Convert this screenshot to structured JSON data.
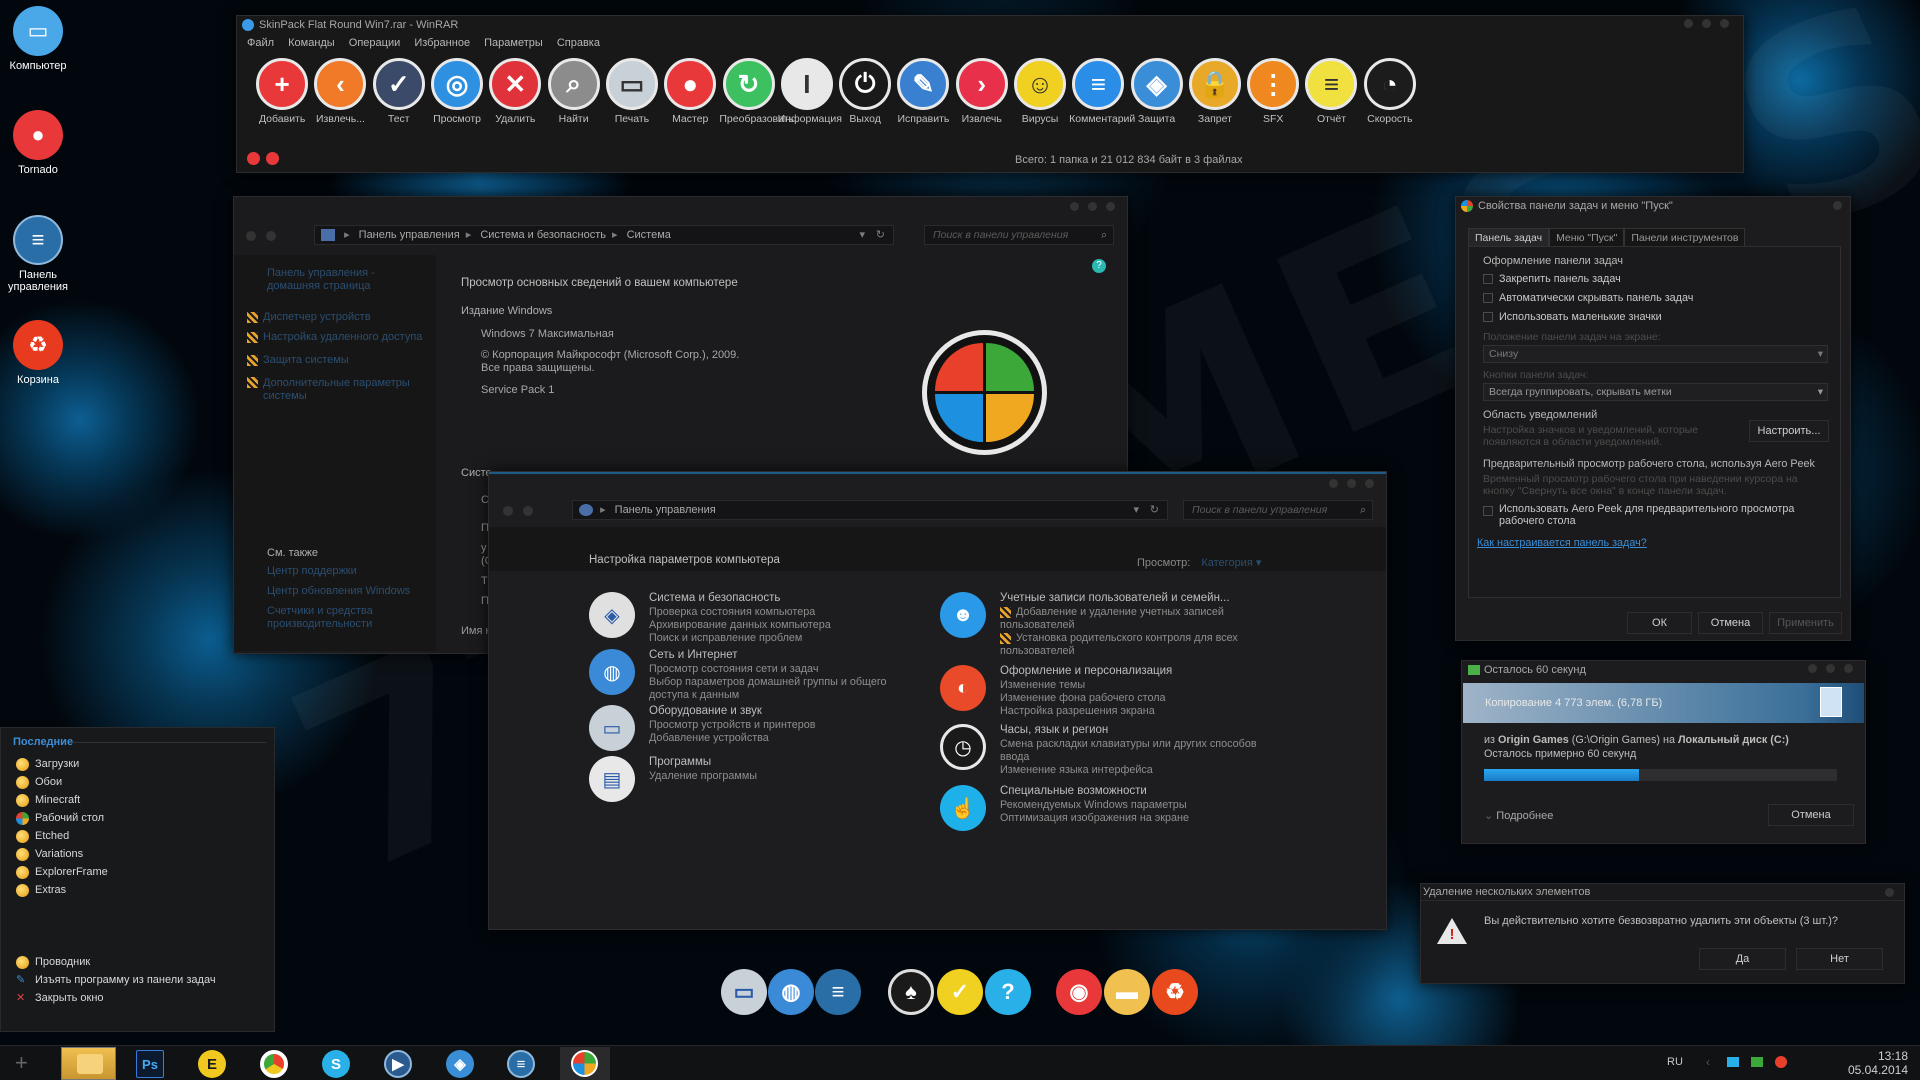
{
  "desktop": {
    "icons": [
      {
        "label": "Компьютер",
        "color": "#4aa8e8"
      },
      {
        "label": "Tornado",
        "color": "#e8383a"
      },
      {
        "label": "Панель управления",
        "color": "#2a6ea8"
      },
      {
        "label": "Корзина",
        "color": "#e73a1e"
      }
    ],
    "watermark": "7THEMES.SU"
  },
  "winrar": {
    "title": "SkinPack Flat Round Win7.rar - WinRAR",
    "menu": [
      "Файл",
      "Команды",
      "Операции",
      "Избранное",
      "Параметры",
      "Справка"
    ],
    "tools": [
      {
        "label": "Добавить",
        "color": "#e8383a",
        "glyph": "+"
      },
      {
        "label": "Извлечь...",
        "color": "#f07a28",
        "glyph": "‹"
      },
      {
        "label": "Тест",
        "color": "#3b4a68",
        "glyph": "✓"
      },
      {
        "label": "Просмотр",
        "color": "#2e90e0",
        "glyph": "◎"
      },
      {
        "label": "Удалить",
        "color": "#e0323a",
        "glyph": "✕"
      },
      {
        "label": "Найти",
        "color": "#8c8c8c",
        "glyph": "⌕"
      },
      {
        "label": "Печать",
        "color": "#c8d0d8",
        "glyph": "▭"
      },
      {
        "label": "Мастер",
        "color": "#e8383a",
        "glyph": "●"
      },
      {
        "label": "Преобразовать",
        "color": "#3cc060",
        "glyph": "↻"
      },
      {
        "label": "Информация",
        "color": "#e8e8e8",
        "glyph": "I"
      },
      {
        "label": "Выход",
        "color": "#1a1a1a",
        "glyph": "⏻"
      },
      {
        "label": "Исправить",
        "color": "#3a80d0",
        "glyph": "✎"
      },
      {
        "label": "Извлечь",
        "color": "#e8304a",
        "glyph": "›"
      },
      {
        "label": "Вирусы",
        "color": "#f0d020",
        "glyph": "☺"
      },
      {
        "label": "Комментарий",
        "color": "#2a8ee8",
        "glyph": "≡"
      },
      {
        "label": "Защита",
        "color": "#3a8ed8",
        "glyph": "◈"
      },
      {
        "label": "Запрет",
        "color": "#e8a828",
        "glyph": "🔒"
      },
      {
        "label": "SFX",
        "color": "#f08820",
        "glyph": "⋮"
      },
      {
        "label": "Отчёт",
        "color": "#f0e040",
        "glyph": "≡"
      },
      {
        "label": "Скорость",
        "color": "#1c1c1c",
        "glyph": "◔"
      }
    ],
    "status": "Всего: 1 папка и 21 012 834 байт в 3 файлах"
  },
  "sysinfo": {
    "breadcrumb": [
      "Панель управления",
      "Система и безопасность",
      "Система"
    ],
    "search_placeholder": "Поиск в панели управления",
    "left_links": [
      "Панель управления - домашняя страница",
      "Диспетчер устройств",
      "Настройка удаленного доступа",
      "Защита системы",
      "Дополнительные параметры системы"
    ],
    "see_also": "См. также",
    "see_also_links": [
      "Центр поддержки",
      "Центр обновления Windows",
      "Счетчики и средства производительности"
    ],
    "heading": "Просмотр основных сведений о вашем компьютере",
    "edition_title": "Издание Windows",
    "edition": "Windows 7 Максимальная",
    "copyright": "© Корпорация Майкрософт (Microsoft Corp.), 2009. Все права защищены.",
    "sp": "Service Pack 1",
    "sys_label": "Систе",
    "name_label": "Имя к",
    "frag": [
      "С",
      "П",
      "у",
      "(С",
      "Т",
      "П"
    ]
  },
  "cpanel": {
    "address": "Панель управления",
    "search_placeholder": "Поиск в панели управления",
    "heading": "Настройка параметров компьютера",
    "view_label": "Просмотр:",
    "view_value": "Категория",
    "categories": [
      {
        "title": "Система и безопасность",
        "links": [
          "Проверка состояния компьютера",
          "Архивирование данных компьютера",
          "Поиск и исправление проблем"
        ],
        "color": "#e0e0e0",
        "glyph": "◈"
      },
      {
        "title": "Сеть и Интернет",
        "links": [
          "Просмотр состояния сети и задач",
          "Выбор параметров домашней группы и общего доступа к данным"
        ],
        "color": "#3a8ad8",
        "glyph": "◍"
      },
      {
        "title": "Оборудование и звук",
        "links": [
          "Просмотр устройств и принтеров",
          "Добавление устройства"
        ],
        "color": "#c8d0d8",
        "glyph": "▭"
      },
      {
        "title": "Программы",
        "links": [
          "Удаление программы"
        ],
        "color": "#e8e8e8",
        "glyph": "▤"
      },
      {
        "title": "Учетные записи пользователей и семейн...",
        "links": [
          "Добавление и удаление учетных записей пользователей",
          "Установка родительского контроля для всех пользователей"
        ],
        "color": "#2a9ae8",
        "glyph": "☻"
      },
      {
        "title": "Оформление и персонализация",
        "links": [
          "Изменение темы",
          "Изменение фона рабочего стола",
          "Настройка разрешения экрана"
        ],
        "color": "#e84a2a",
        "glyph": "◐"
      },
      {
        "title": "Часы, язык и регион",
        "links": [
          "Смена раскладки клавиатуры или других способов ввода",
          "Изменение языка интерфейса"
        ],
        "color": "#1a1a1a",
        "glyph": "◷"
      },
      {
        "title": "Специальные возможности",
        "links": [
          "Рекомендуемых Windows параметры",
          "Оптимизация изображения на экране"
        ],
        "color": "#1eb0e8",
        "glyph": "☝"
      }
    ]
  },
  "props": {
    "title": "Свойства панели задач и меню \"Пуск\"",
    "tabs": [
      "Панель задач",
      "Меню \"Пуск\"",
      "Панели инструментов"
    ],
    "group1": "Оформление панели задач",
    "checks": [
      "Закрепить панель задач",
      "Автоматически скрывать панель задач",
      "Использовать маленькие значки"
    ],
    "pos_label": "Положение панели задач на экране:",
    "pos_value": "Снизу",
    "btn_label": "Кнопки панели задач:",
    "btn_value": "Всегда группировать, скрывать метки",
    "notify_title": "Область уведомлений",
    "notify_text": "Настройка значков и уведомлений, которые появляются в области уведомлений.",
    "customize": "Настроить...",
    "peek_title": "Предварительный просмотр рабочего стола, используя Aero Peek",
    "peek_text": "Временный просмотр рабочего стола при наведении курсора на кнопку \"Свернуть все окна\" в конце панели задач.",
    "peek_check": "Использовать Aero Peek для предварительного просмотра рабочего стола",
    "help_link": "Как настраивается панель задач?",
    "ok": "ОК",
    "cancel": "Отмена",
    "apply": "Применить"
  },
  "copy": {
    "title": "Осталось 60 секунд",
    "banner": "Копирование 4 773 элем. (6,78 ГБ)",
    "from_prefix": "из",
    "from_bold": "Origin Games",
    "from_path": "(G:\\Origin Games) на",
    "to_bold": "Локальный диск (C:)",
    "remain": "Осталось примерно 60 секунд",
    "progress": 0.44,
    "more": "Подробнее",
    "cancel": "Отмена"
  },
  "delete": {
    "title": "Удаление нескольких элементов",
    "message": "Вы действительно хотите безвозвратно удалить эти объекты (3 шт.)?",
    "yes": "Да",
    "no": "Нет"
  },
  "start": {
    "header": "Последние",
    "items": [
      "Загрузки",
      "Обои",
      "Minecraft",
      "Рабочий стол",
      "Etched",
      "Variations",
      "ExplorerFrame",
      "Extras"
    ],
    "app": "Проводник",
    "unpin": "Изъять программу из панели задач",
    "close": "Закрыть окно"
  },
  "taskbar": {
    "apps": [
      "Explorer",
      "Photoshop",
      "E",
      "Chrome",
      "Skype",
      "Media Player",
      "WinRAR",
      "Control Panel",
      "Windows"
    ],
    "lang": "RU",
    "time": "13:18",
    "date": "05.04.2014"
  },
  "dock": [
    {
      "name": "drive",
      "color": "#c8d0d8"
    },
    {
      "name": "network",
      "color": "#3a8ad8"
    },
    {
      "name": "control-panel",
      "color": "#2a6ea8"
    },
    {
      "name": "cards",
      "color": "#1a1a1a"
    },
    {
      "name": "check",
      "color": "#f0d020"
    },
    {
      "name": "help",
      "color": "#2ab0e8"
    },
    {
      "name": "media",
      "color": "#e8383a"
    },
    {
      "name": "folder",
      "color": "#f0c050"
    },
    {
      "name": "recycle",
      "color": "#e84a1e"
    }
  ]
}
